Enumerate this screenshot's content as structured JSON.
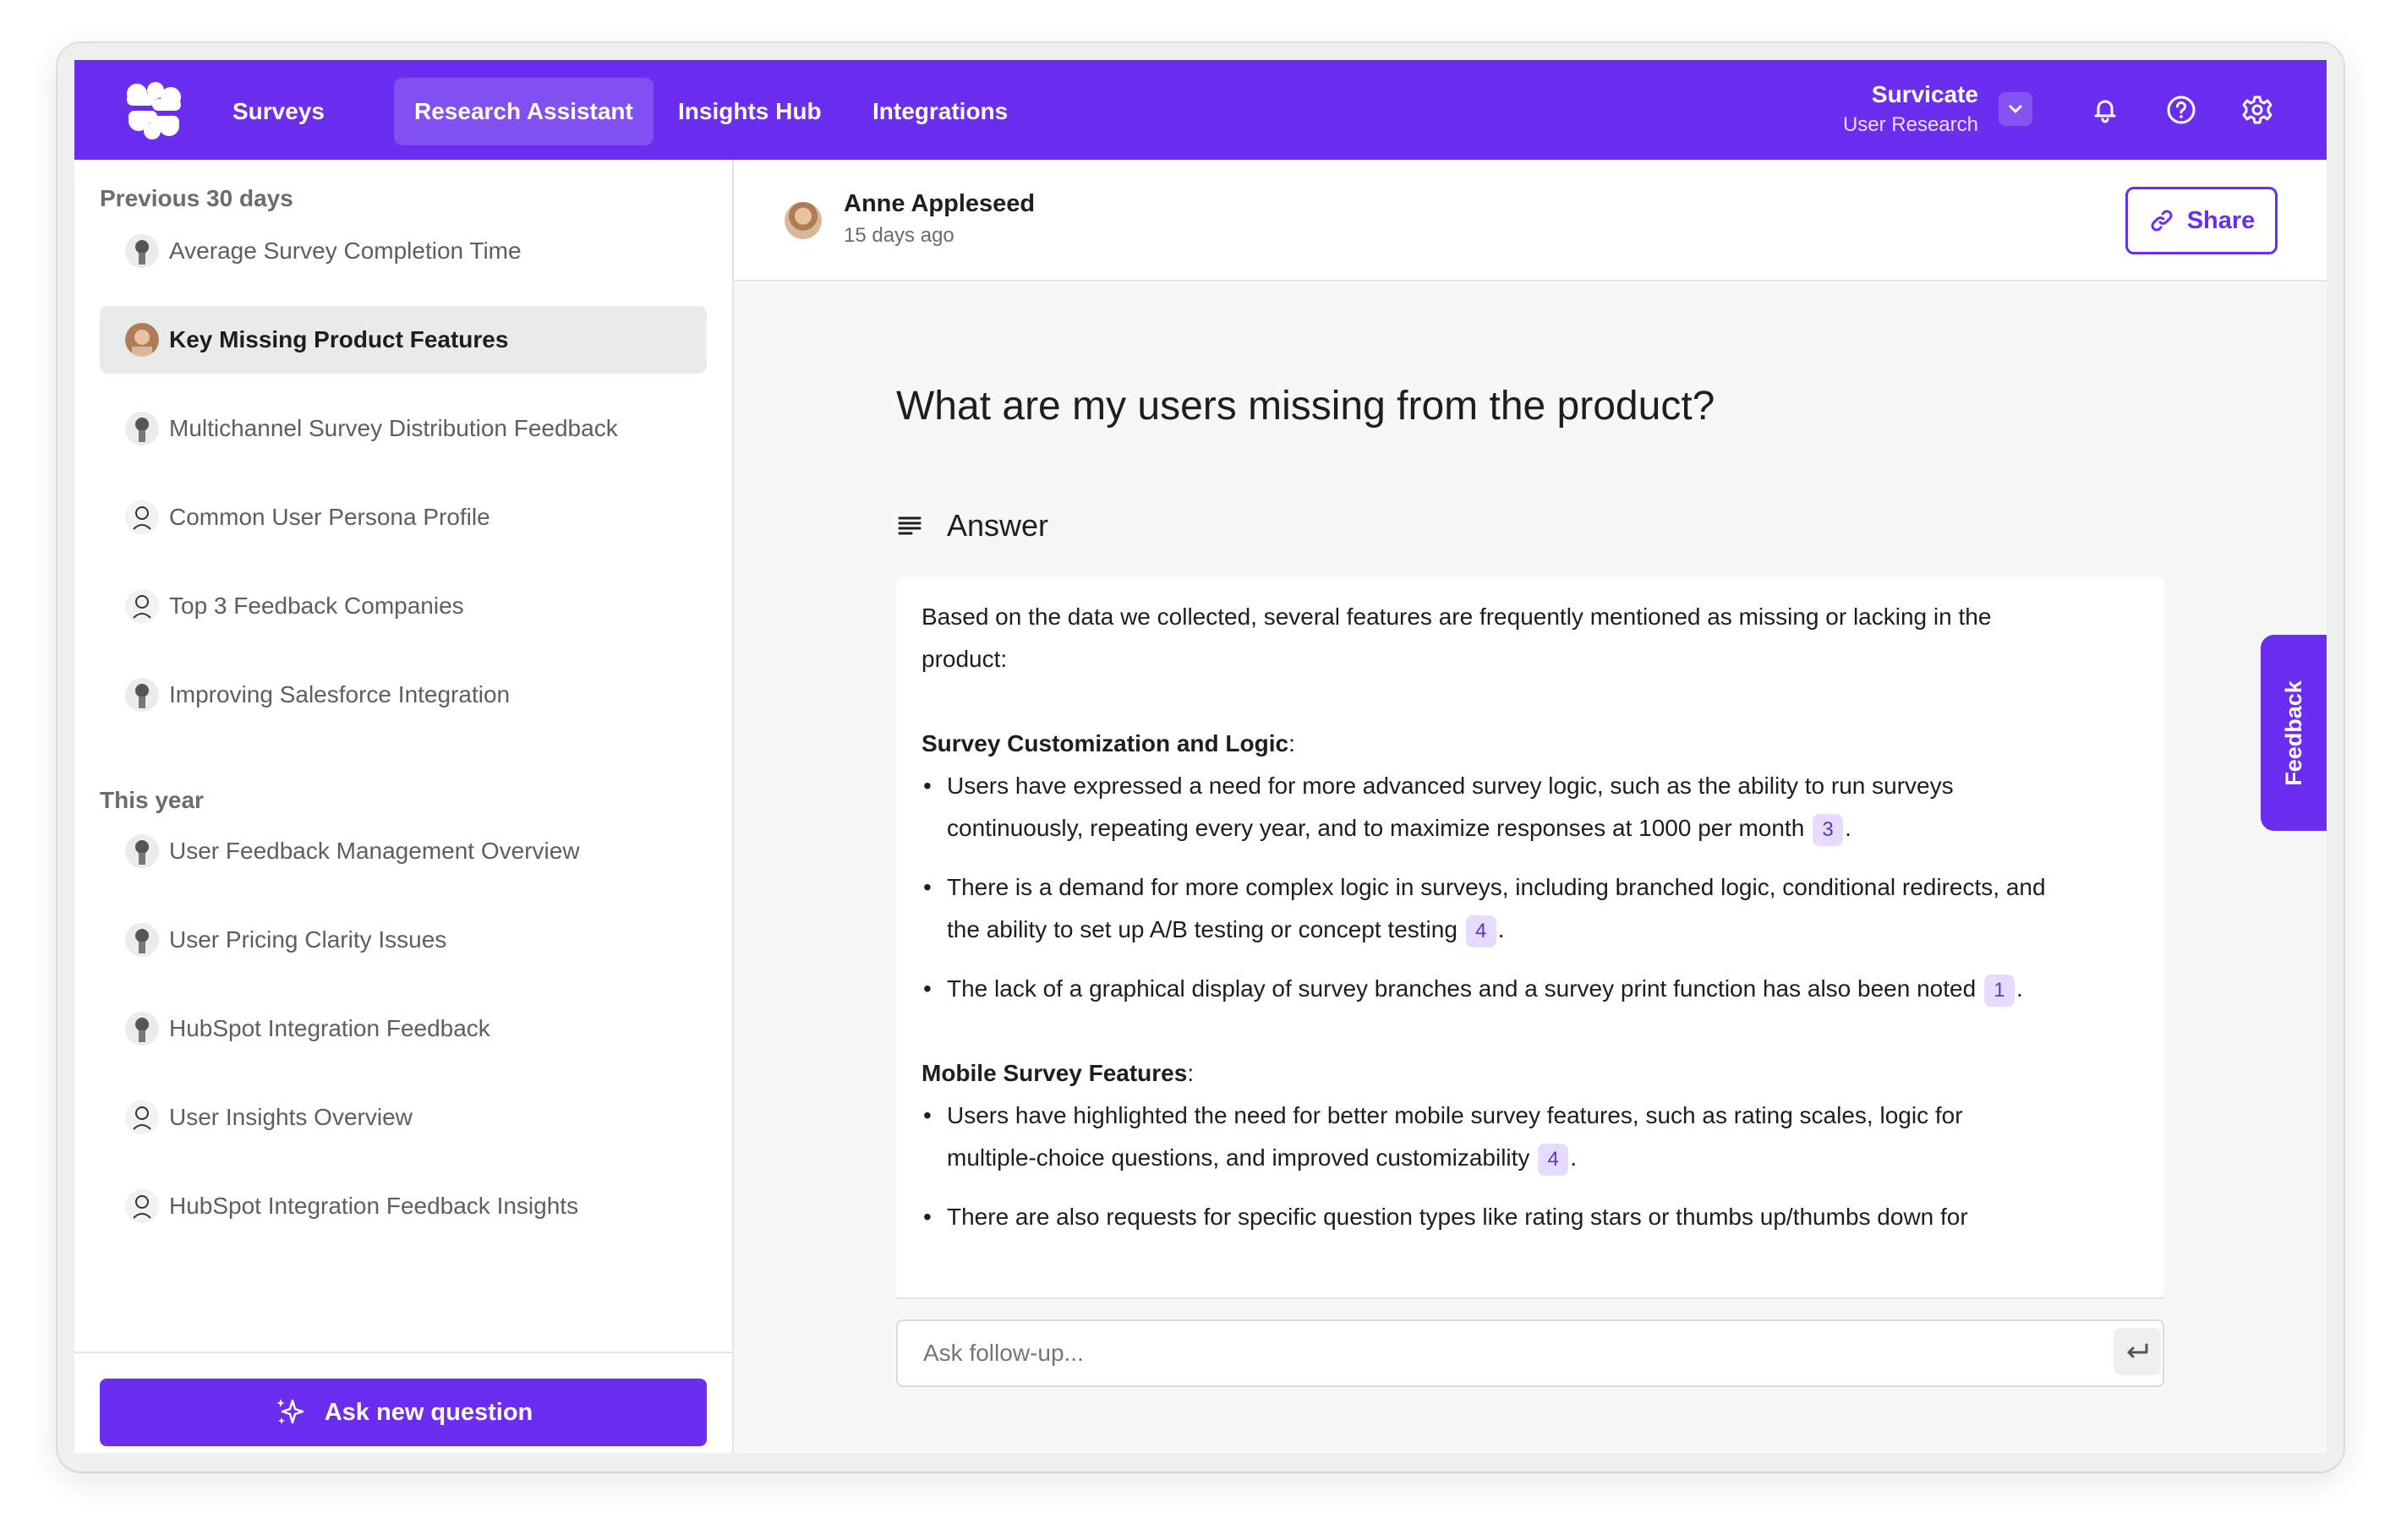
{
  "nav": {
    "items": [
      {
        "label": "Surveys"
      },
      {
        "label": "Research Assistant"
      },
      {
        "label": "Insights Hub"
      },
      {
        "label": "Integrations"
      }
    ],
    "workspace_name": "Survicate",
    "workspace_sub": "User Research"
  },
  "sidebar": {
    "section1": "Previous 30 days",
    "section2": "This year",
    "items": [
      {
        "label": "Average Survey Completion Time"
      },
      {
        "label": "Key Missing Product Features"
      },
      {
        "label": "Multichannel Survey Distribution Feedback"
      },
      {
        "label": "Common User Persona Profile"
      },
      {
        "label": "Top 3 Feedback Companies"
      },
      {
        "label": "Improving Salesforce Integration"
      },
      {
        "label": "User Feedback Management Overview"
      },
      {
        "label": "User Pricing Clarity Issues"
      },
      {
        "label": "HubSpot Integration Feedback"
      },
      {
        "label": "User Insights Overview"
      },
      {
        "label": "HubSpot Integration Feedback Insights"
      }
    ],
    "ask_button": "Ask new question"
  },
  "header": {
    "author": "Anne Appleseed",
    "time": "15 days ago",
    "share_label": "Share"
  },
  "question": "What are my users missing from the product?",
  "answer": {
    "label": "Answer",
    "intro": "Based on the data we collected, several features are frequently mentioned as missing or lacking in the product:",
    "section1_title": "Survey Customization and Logic",
    "s1_b1": "Users have expressed a need for more advanced survey logic, such as the ability to run surveys continuously, repeating every year, and to maximize responses at 1000 per month",
    "s1_b1_cite": "3",
    "s1_b2": "There is a demand for more complex logic in surveys, including branched logic, conditional redirects, and the ability to set up A/B testing or concept testing",
    "s1_b2_cite": "4",
    "s1_b3": "The lack of a graphical display of survey branches and a survey print function has also been noted",
    "s1_b3_cite": "1",
    "section2_title": "Mobile Survey Features",
    "s2_b1": "Users have highlighted the need for better mobile survey features, such as rating scales, logic for multiple-choice questions, and improved customizability",
    "s2_b1_cite": "4",
    "s2_b2": "There are also requests for specific question types like rating stars or thumbs up/thumbs down for"
  },
  "followup": {
    "placeholder": "Ask follow-up..."
  },
  "feedback_tab": "Feedback",
  "colors": {
    "accent": "#6b2ef0",
    "citation_bg": "#e6dcff"
  }
}
